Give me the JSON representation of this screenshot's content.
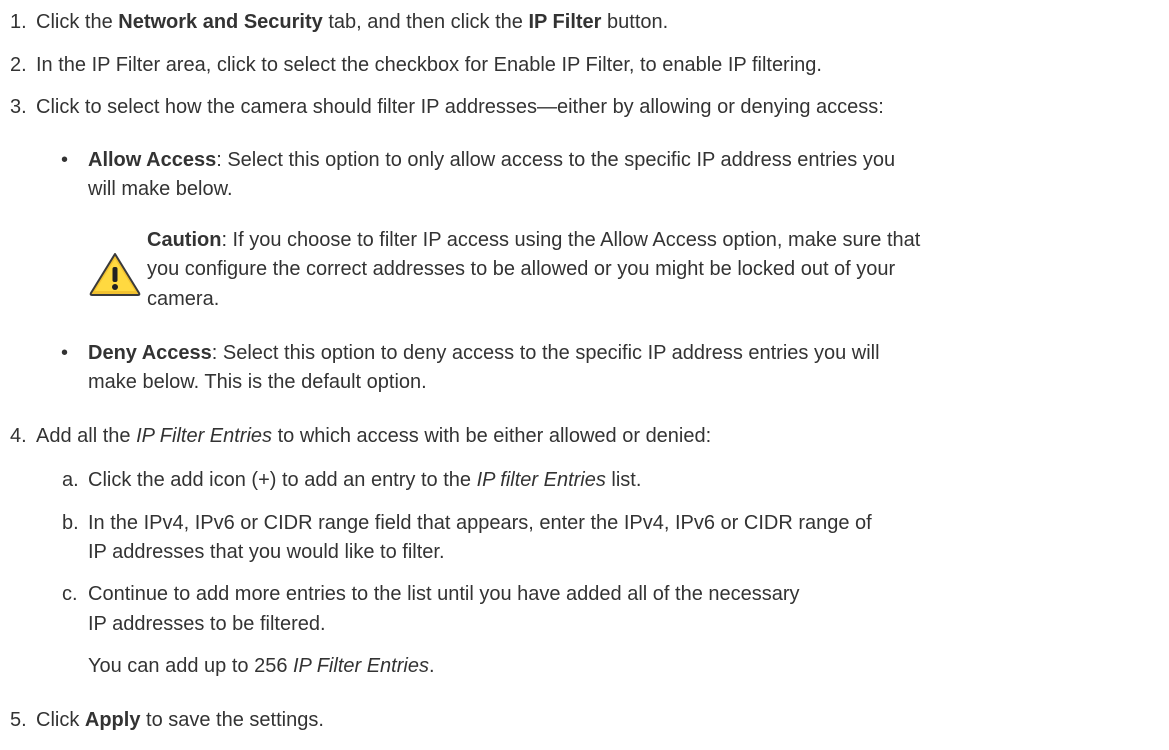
{
  "steps": [
    {
      "number": "1.",
      "pre": "Click the ",
      "bold1": "Network and Security",
      "mid": " tab, and then click the ",
      "bold2": "IP Filter",
      "post": " button."
    },
    {
      "number": "2.",
      "text": "In the IP Filter area, click to select the checkbox for Enable IP Filter, to enable IP filtering."
    },
    {
      "number": "3.",
      "text": "Click to select how the camera should filter IP addresses—either by allowing or denying access:",
      "bullets": [
        {
          "marker": "•",
          "label": "Allow Access",
          "line1": ": Select this option to only allow access to the specific IP address entries you",
          "line2": "will make below.",
          "caution": {
            "icon": "warning-triangle-icon",
            "label": "Caution",
            "line1": ": If you choose to filter IP access using the Allow Access option, make sure that",
            "line2": "you configure the correct addresses to be allowed or you might be locked out of your",
            "line3": "camera."
          }
        },
        {
          "marker": "•",
          "label": "Deny Access",
          "line1": ": Select this option to deny access to the specific IP address entries you will",
          "line2": "make below. This is the default option."
        }
      ]
    },
    {
      "number": "4.",
      "pre": "Add all the ",
      "italic": "IP Filter Entries",
      "post": " to which access with be either allowed or denied:",
      "substeps": [
        {
          "marker": "a.",
          "pre": "Click the add icon (+) to add an entry to the ",
          "italic": "IP filter Entries",
          "post": " list."
        },
        {
          "marker": "b.",
          "line1": "In the IPv4, IPv6 or CIDR range field that appears, enter the IPv4, IPv6 or CIDR range of",
          "line2": "IP addresses that you would like to filter."
        },
        {
          "marker": "c.",
          "line1": "Continue to add more entries to the list until you have added all of the necessary",
          "line2": "IP addresses to be filtered.",
          "note_pre": "You can add up to 256 ",
          "note_italic": "IP Filter Entries",
          "note_post": "."
        }
      ]
    },
    {
      "number": "5.",
      "pre": "Click ",
      "bold": "Apply",
      "post": " to save the settings."
    }
  ]
}
